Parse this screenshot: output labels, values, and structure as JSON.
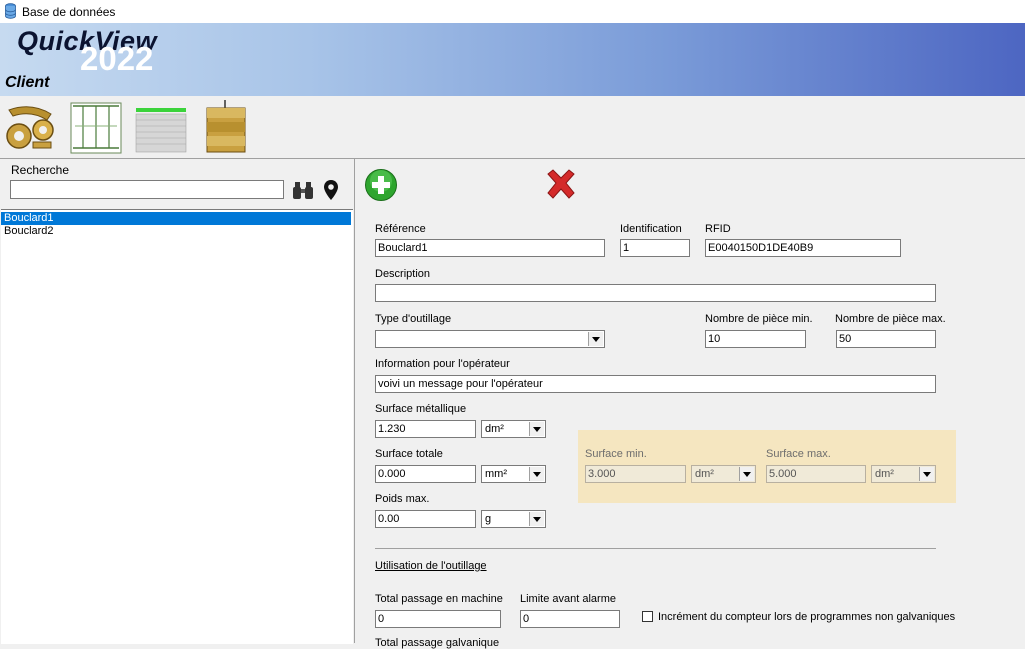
{
  "window": {
    "title": "Base de données"
  },
  "banner": {
    "brand": "QuickView",
    "year": "2022",
    "module": "Client"
  },
  "search": {
    "label": "Recherche",
    "value": ""
  },
  "list": {
    "items": [
      "Bouclard1",
      "Bouclard2"
    ],
    "selected_index": 0
  },
  "form": {
    "reference": {
      "label": "Référence",
      "value": "Bouclard1"
    },
    "identification": {
      "label": "Identification",
      "value": "1"
    },
    "rfid": {
      "label": "RFID",
      "value": "E0040150D1DE40B9"
    },
    "description": {
      "label": "Description",
      "value": ""
    },
    "tool_type": {
      "label": "Type d'outillage",
      "value": ""
    },
    "min_pieces": {
      "label": "Nombre de pièce min.",
      "value": "10"
    },
    "max_pieces": {
      "label": "Nombre de pièce max.",
      "value": "50"
    },
    "operator_info": {
      "label": "Information pour l'opérateur",
      "value": "voivi un message pour l'opérateur"
    },
    "metal_surface": {
      "label": "Surface métallique",
      "value": "1.230",
      "unit": "dm²"
    },
    "total_surface": {
      "label": "Surface totale",
      "value": "0.000",
      "unit": "mm²"
    },
    "max_weight": {
      "label": "Poids max.",
      "value": "0.00",
      "unit": "g"
    },
    "surface_min": {
      "label": "Surface min.",
      "value": "3.000",
      "unit": "dm²"
    },
    "surface_max": {
      "label": "Surface max.",
      "value": "5.000",
      "unit": "dm²"
    },
    "usage_section": {
      "label": "Utilisation de l'outillage"
    },
    "total_machine": {
      "label": "Total passage en machine",
      "value": "0"
    },
    "alarm_limit": {
      "label": "Limite avant alarme",
      "value": "0"
    },
    "increment_checkbox": {
      "label": "Incrément du compteur lors de programmes non galvaniques",
      "checked": false
    },
    "total_galvanic": {
      "label": "Total passage galvanique"
    }
  },
  "colors": {
    "selection": "#0078d7",
    "panel_highlight": "#f5e6c0",
    "add_green": "#2ea52e",
    "delete_red": "#d42a2a"
  }
}
